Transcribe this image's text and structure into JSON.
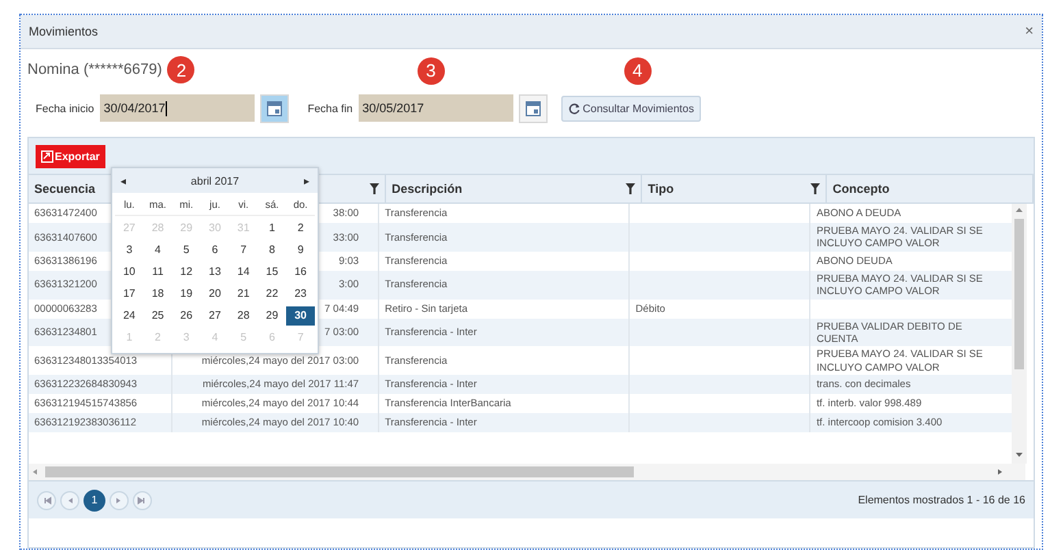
{
  "window": {
    "title": "Movimientos",
    "close": "×"
  },
  "account": "Nomina (******6679)",
  "filters": [
    {
      "label": "Fecha inicio",
      "value": "30/04/2017",
      "focused": true
    },
    {
      "label": "Fecha fin",
      "value": "30/05/2017",
      "focused": false
    }
  ],
  "query_button": "Consultar Movimientos",
  "markers": [
    "2",
    "3",
    "4"
  ],
  "export_button": "Exportar",
  "calendar": {
    "title": "abril 2017",
    "prev": "◂",
    "next": "▸",
    "weekdays": [
      "lu.",
      "ma.",
      "mi.",
      "ju.",
      "vi.",
      "sá.",
      "do."
    ],
    "weeks": [
      [
        {
          "d": "27",
          "other": true,
          "selected": false
        },
        {
          "d": "28",
          "other": true,
          "selected": false
        },
        {
          "d": "29",
          "other": true,
          "selected": false
        },
        {
          "d": "30",
          "other": true,
          "selected": false
        },
        {
          "d": "31",
          "other": true,
          "selected": false
        },
        {
          "d": "1",
          "other": false,
          "selected": false
        },
        {
          "d": "2",
          "other": false,
          "selected": false
        }
      ],
      [
        {
          "d": "3",
          "other": false,
          "selected": false
        },
        {
          "d": "4",
          "other": false,
          "selected": false
        },
        {
          "d": "5",
          "other": false,
          "selected": false
        },
        {
          "d": "6",
          "other": false,
          "selected": false
        },
        {
          "d": "7",
          "other": false,
          "selected": false
        },
        {
          "d": "8",
          "other": false,
          "selected": false
        },
        {
          "d": "9",
          "other": false,
          "selected": false
        }
      ],
      [
        {
          "d": "10",
          "other": false,
          "selected": false
        },
        {
          "d": "11",
          "other": false,
          "selected": false
        },
        {
          "d": "12",
          "other": false,
          "selected": false
        },
        {
          "d": "13",
          "other": false,
          "selected": false
        },
        {
          "d": "14",
          "other": false,
          "selected": false
        },
        {
          "d": "15",
          "other": false,
          "selected": false
        },
        {
          "d": "16",
          "other": false,
          "selected": false
        }
      ],
      [
        {
          "d": "17",
          "other": false,
          "selected": false
        },
        {
          "d": "18",
          "other": false,
          "selected": false
        },
        {
          "d": "19",
          "other": false,
          "selected": false
        },
        {
          "d": "20",
          "other": false,
          "selected": false
        },
        {
          "d": "21",
          "other": false,
          "selected": false
        },
        {
          "d": "22",
          "other": false,
          "selected": false
        },
        {
          "d": "23",
          "other": false,
          "selected": false
        }
      ],
      [
        {
          "d": "24",
          "other": false,
          "selected": false
        },
        {
          "d": "25",
          "other": false,
          "selected": false
        },
        {
          "d": "26",
          "other": false,
          "selected": false
        },
        {
          "d": "27",
          "other": false,
          "selected": false
        },
        {
          "d": "28",
          "other": false,
          "selected": false
        },
        {
          "d": "29",
          "other": false,
          "selected": false
        },
        {
          "d": "30",
          "other": false,
          "selected": true
        }
      ],
      [
        {
          "d": "1",
          "other": true,
          "selected": false
        },
        {
          "d": "2",
          "other": true,
          "selected": false
        },
        {
          "d": "3",
          "other": true,
          "selected": false
        },
        {
          "d": "4",
          "other": true,
          "selected": false
        },
        {
          "d": "5",
          "other": true,
          "selected": false
        },
        {
          "d": "6",
          "other": true,
          "selected": false
        },
        {
          "d": "7",
          "other": true,
          "selected": false
        }
      ]
    ]
  },
  "table": {
    "columns": [
      {
        "label": "Secuencia",
        "filter": false
      },
      {
        "filter": true
      },
      {
        "label": "Descripción",
        "filter": true
      },
      {
        "label": "Tipo",
        "filter": true
      },
      {
        "label": "Concepto",
        "filter": false
      }
    ],
    "rows": [
      [
        "63631472400",
        "38:00",
        "Transferencia",
        "",
        "ABONO A DEUDA"
      ],
      [
        "63631407600",
        "33:00",
        "Transferencia",
        "",
        "PRUEBA MAYO 24. VALIDAR SI SE INCLUYO CAMPO VALOR"
      ],
      [
        "63631386196",
        "9:03",
        "Transferencia",
        "",
        "ABONO DEUDA"
      ],
      [
        "63631321200",
        "3:00",
        "Transferencia",
        "",
        "PRUEBA MAYO 24. VALIDAR SI SE INCLUYO CAMPO VALOR"
      ],
      [
        "00000063283",
        "7 04:49",
        "Retiro - Sin tarjeta",
        "Débito",
        ""
      ],
      [
        "63631234801",
        "7 03:00",
        "Transferencia - Inter",
        "",
        "PRUEBA VALIDAR DEBITO DE CUENTA"
      ],
      [
        "636312348013354013",
        "miércoles,24 mayo del 2017 03:00",
        "Transferencia",
        "",
        "PRUEBA MAYO 24. VALIDAR SI SE INCLUYO CAMPO VALOR"
      ],
      [
        "636312232684830943",
        "miércoles,24 mayo del 2017 11:47",
        "Transferencia - Inter",
        "",
        "trans. con decimales"
      ],
      [
        "636312194515743856",
        "miércoles,24 mayo del 2017 10:44",
        "Transferencia InterBancaria",
        "",
        "tf. interb. valor 998.489"
      ],
      [
        "636312192383036112",
        "miércoles,24 mayo del 2017 10:40",
        "Transferencia - Inter",
        "",
        "tf. intercoop comision 3.400"
      ]
    ]
  },
  "pager": {
    "pages": [
      {
        "label": "1",
        "selected": true
      }
    ],
    "info": "Elementos mostrados 1 - 16 de 16"
  }
}
